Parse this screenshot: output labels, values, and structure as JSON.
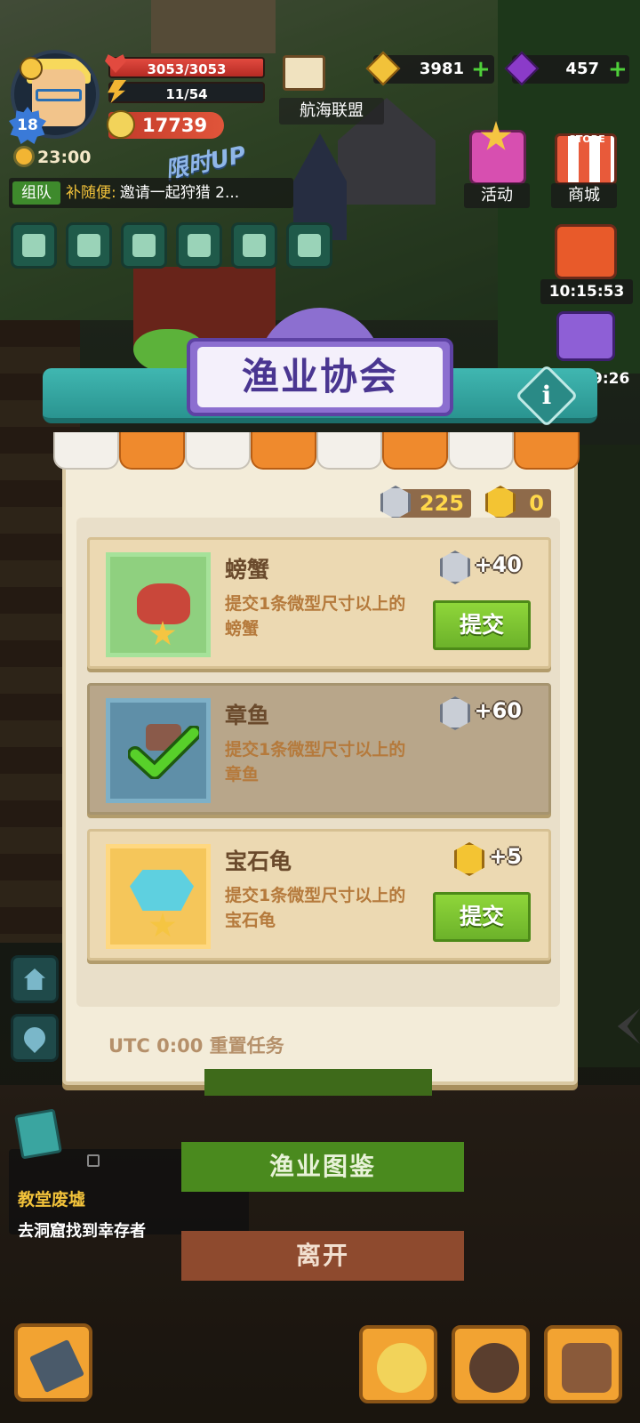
{
  "player": {
    "level": "18",
    "hp": "3053/3053",
    "energy": "11/54",
    "coins": "17739",
    "time": "23:00"
  },
  "alliance": {
    "label": "航海联盟"
  },
  "currencies": {
    "gold": "3981",
    "gems": "457"
  },
  "team": {
    "tag": "组队",
    "name": "补随便:",
    "message": "邀请一起狩猎 2..."
  },
  "event_badge": "限时UP",
  "side_buttons": {
    "activity": "活动",
    "store": "商城",
    "store_tag": "STORE",
    "gift_timer": "10:15:53",
    "chest_timer": "9:26"
  },
  "modal": {
    "title": "渔业协会",
    "tokens": {
      "silver": "225",
      "gold": "0"
    },
    "quests": [
      {
        "name": "螃蟹",
        "desc": "提交1条微型尺寸以上的螃蟹",
        "reward": "+40",
        "reward_type": "silver",
        "status": "open",
        "button": "提交"
      },
      {
        "name": "章鱼",
        "desc": "提交1条微型尺寸以上的章鱼",
        "reward": "+60",
        "reward_type": "silver",
        "status": "completed"
      },
      {
        "name": "宝石龟",
        "desc": "提交1条微型尺寸以上的宝石龟",
        "reward": "+5",
        "reward_type": "gold",
        "status": "open",
        "button": "提交"
      }
    ],
    "reset_note": "UTC 0:00 重置任务"
  },
  "tracker": {
    "title": "教堂废墟",
    "desc": "去洞窟找到幸存者"
  },
  "buttons": {
    "fish_guide": "渔业图鉴",
    "leave": "离开"
  },
  "colors": {
    "accent_teal": "#2a9490",
    "title_purple": "#8c6fd0",
    "submit_green": "#6cb22a",
    "token_yellow": "#ffd84a"
  }
}
